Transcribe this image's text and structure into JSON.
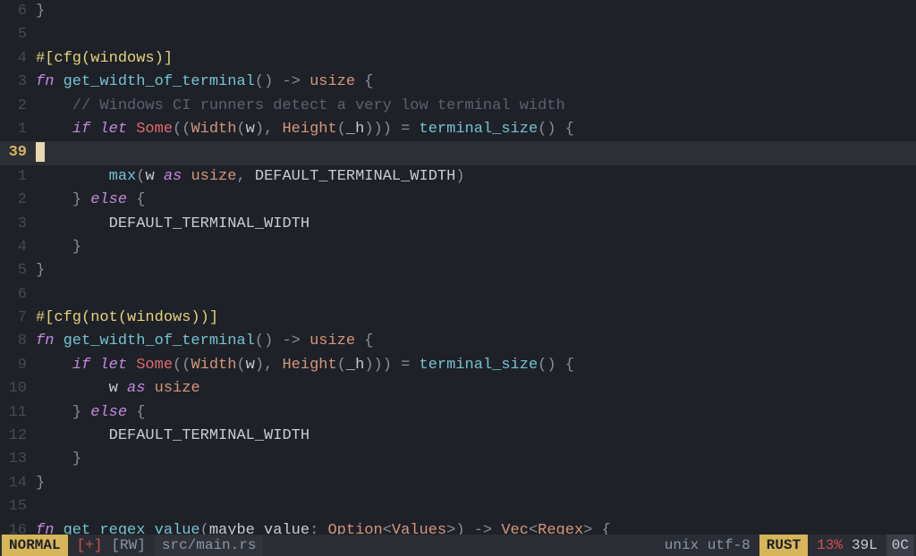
{
  "gutter": [
    "6",
    "5",
    "4",
    "3",
    "2",
    "1",
    "39",
    "1",
    "2",
    "3",
    "4",
    "5",
    "6",
    "7",
    "8",
    "9",
    "10",
    "11",
    "12",
    "13",
    "14",
    "15",
    "16"
  ],
  "current_line_index": 6,
  "tokens": {
    "brace_close": "}",
    "brace_open": "{",
    "paren_open": "(",
    "paren_close": ")",
    "comma": ",",
    "arrow": "->",
    "lt": "<",
    "gt": ">",
    "eq": "=",
    "colon": ":",
    "attr_win": "#[cfg(windows)]",
    "attr_notwin": "#[cfg(not(windows))]",
    "fn": "fn",
    "if": "if",
    "let": "let",
    "else": "else",
    "as": "as",
    "Some": "Some",
    "usize": "usize",
    "Width": "Width",
    "Height": "Height",
    "Option": "Option",
    "Values": "Values",
    "Vec": "Vec",
    "Regex": "Regex",
    "get_width_of_terminal": "get_width_of_terminal",
    "get_regex_value": "get_regex_value",
    "terminal_size": "terminal_size",
    "max": "max",
    "w": "w",
    "_h": "_h",
    "maybe_value": "maybe_value",
    "DEFAULT_TERMINAL_WIDTH": "DEFAULT_TERMINAL_WIDTH",
    "comment_win": "// Windows CI runners detect a very low terminal width"
  },
  "status": {
    "mode": "NORMAL",
    "modified": "[+]",
    "rw": "[RW]",
    "file": "src/main.rs",
    "encoding": "unix utf-8",
    "filetype": "RUST",
    "percent": "13%",
    "lines": "39L",
    "col": "0C"
  }
}
